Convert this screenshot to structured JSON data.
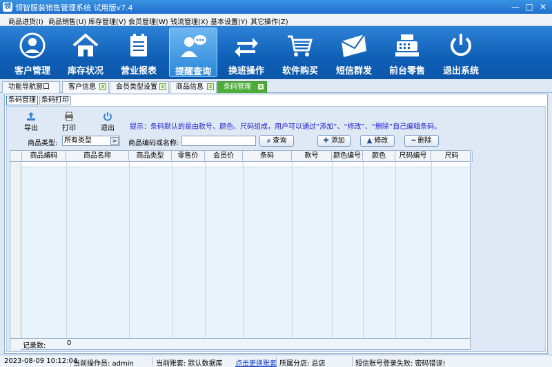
{
  "window": {
    "title": "领智服装销售管理系统 试用版v7.4",
    "controls": [
      "—",
      "□",
      "✕"
    ]
  },
  "menu": [
    "商品进货(I)",
    "商品销售(U)",
    "库存管理(V)",
    "会员管理(W)",
    "钱流管理(X)",
    "基本设置(Y)",
    "其它操作(Z)"
  ],
  "toolbar": {
    "buttons": [
      {
        "label": "客户管理",
        "icon": "user-circle-icon"
      },
      {
        "label": "库存状况",
        "icon": "home-icon"
      },
      {
        "label": "营业报表",
        "icon": "report-icon"
      },
      {
        "label": "提醒查询",
        "icon": "user-chat-icon",
        "active": true
      },
      {
        "label": "换班操作",
        "icon": "exchange-icon"
      },
      {
        "label": "软件购买",
        "icon": "cart-icon"
      },
      {
        "label": "短信群发",
        "icon": "envelope-icon"
      },
      {
        "label": "前台零售",
        "icon": "cash-register-icon"
      },
      {
        "label": "退出系统",
        "icon": "power-icon"
      }
    ]
  },
  "tabs": [
    {
      "label": "功能导航窗口",
      "closable": false
    },
    {
      "label": "客户信息",
      "closable": true
    },
    {
      "label": "会员类型设置",
      "closable": true
    },
    {
      "label": "商品信息",
      "closable": true
    },
    {
      "label": "条码管理",
      "closable": true,
      "active": true
    }
  ],
  "subtabs": [
    {
      "label": "条码管理",
      "active": true
    },
    {
      "label": "条码打印",
      "active": false
    }
  ],
  "actions": {
    "export": "导出",
    "print": "打印",
    "exit": "退出"
  },
  "hint": "提示：条码默认的是由款号、颜色、尺码组成，用户可以通过“添加”、“修改”、“删除”自己编辑条码。",
  "filters": {
    "type_label": "商品类型:",
    "type_value": "所有类型",
    "code_label": "商品编码或名称:",
    "code_value": "",
    "search": "查询",
    "add": "添加",
    "edit": "修改",
    "delete": "删除"
  },
  "grid": {
    "columns": [
      "商品编码",
      "商品名称",
      "商品类型",
      "零售价",
      "会员价",
      "条码",
      "款号",
      "颜色编号",
      "颜色",
      "尺码编号",
      "尺码"
    ],
    "footer_label": "记录数:",
    "footer_value": "0"
  },
  "status": {
    "datetime": "2023-08-09 10:12:04",
    "operator": "当前操作员: admin",
    "account": "当前账套: 默认数据库",
    "switch_link": "点击更换账套",
    "branch": "所属分店: 总店",
    "sms": "短信账号登录失败: 密码错误!"
  },
  "colors": {
    "toolbar": "#0f5fb7",
    "active_tab": "#4cae3a",
    "hint_text": "#1a1ad0"
  }
}
